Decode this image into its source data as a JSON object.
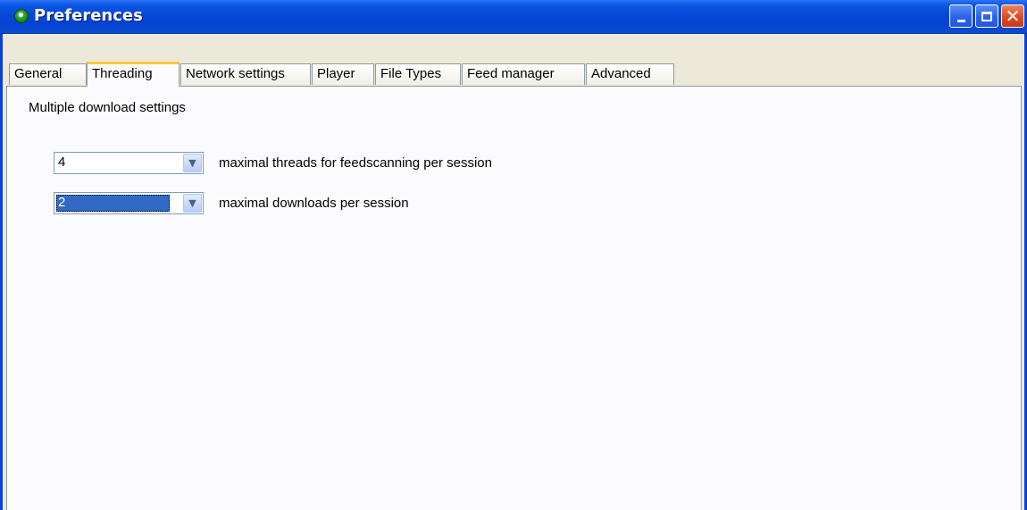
{
  "window": {
    "title": "Preferences"
  },
  "tabs": [
    {
      "label": "General"
    },
    {
      "label": "Threading"
    },
    {
      "label": "Network settings"
    },
    {
      "label": "Player"
    },
    {
      "label": "File Types"
    },
    {
      "label": "Feed manager"
    },
    {
      "label": "Advanced"
    }
  ],
  "active_tab": "Threading",
  "threading": {
    "group_label": "Multiple download settings",
    "feedscan_threads": {
      "value": "4",
      "label": "maximal threads for feedscanning per session"
    },
    "downloads": {
      "value": "2",
      "label": "maximal downloads per session"
    }
  },
  "colors": {
    "titlebar": "#0842d6",
    "selection": "#316ac5",
    "active_tab_accent": "#ffc83c",
    "close_button": "#df4a1e"
  }
}
